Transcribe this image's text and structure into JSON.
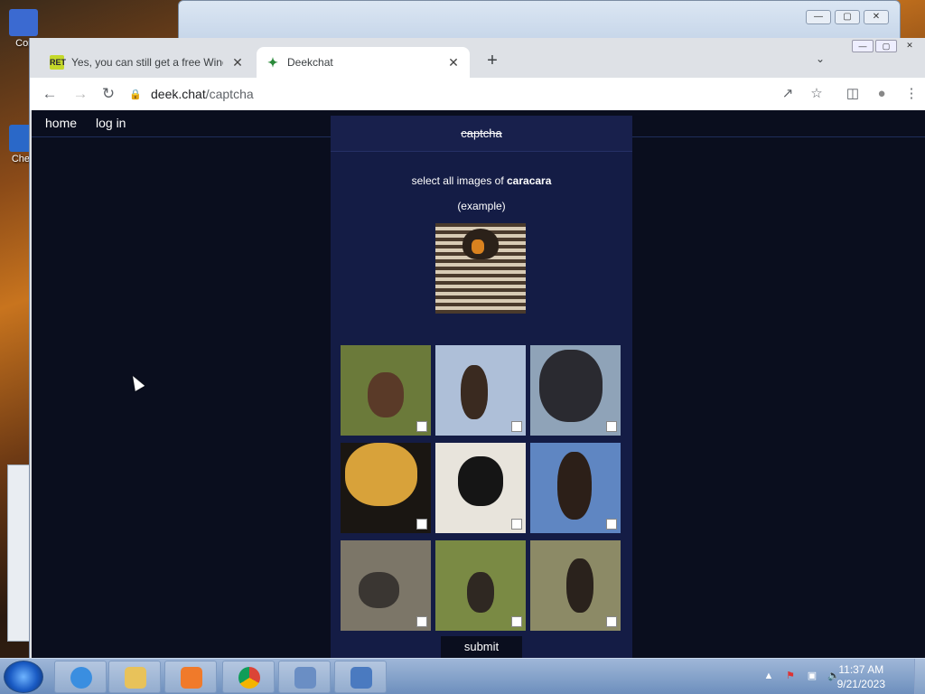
{
  "desktop": {
    "icons": [
      {
        "label": "Cor",
        "color": "#3b6ad1"
      },
      {
        "label": "Chea",
        "color": "#2a68c8"
      }
    ]
  },
  "browser": {
    "tabs": [
      {
        "title": "Yes, you can still get a free Windo",
        "favicon": "RET",
        "active": false
      },
      {
        "title": "Deekchat",
        "favicon": "bird-icon",
        "active": true
      }
    ],
    "url_host": "deek.chat",
    "url_path": "/captcha"
  },
  "site": {
    "nav": [
      "home",
      "log in"
    ],
    "captcha": {
      "heading": "captcha",
      "instruction_prefix": "select all images of ",
      "target": "caracara",
      "example_label": "(example)",
      "tiles": [
        {
          "name": "tile-1",
          "bg": "#6b7a3a",
          "bird": "#5a3a28"
        },
        {
          "name": "tile-2",
          "bg": "#aebfd8",
          "bird": "#3a2a20"
        },
        {
          "name": "tile-3",
          "bg": "#8fa3b8",
          "bird": "#2a2a30"
        },
        {
          "name": "tile-4",
          "bg": "#1a1612",
          "bird": "#d8a23a"
        },
        {
          "name": "tile-5",
          "bg": "#e8e4dc",
          "bird": "#151515"
        },
        {
          "name": "tile-6",
          "bg": "#5f86c2",
          "bird": "#2c1f18"
        },
        {
          "name": "tile-7",
          "bg": "#7c7668",
          "bird": "#3a3632"
        },
        {
          "name": "tile-8",
          "bg": "#7a8a44",
          "bird": "#2f2822"
        },
        {
          "name": "tile-9",
          "bg": "#8c8a66",
          "bird": "#2a221c"
        }
      ],
      "submit_label": "submit"
    }
  },
  "taskbar": {
    "clock_time": "11:37 AM",
    "clock_date": "9/21/2023",
    "apps": [
      "ie-icon",
      "explorer-icon",
      "media-player-icon",
      "chrome-icon",
      "window-icon",
      "control-panel-icon"
    ]
  }
}
